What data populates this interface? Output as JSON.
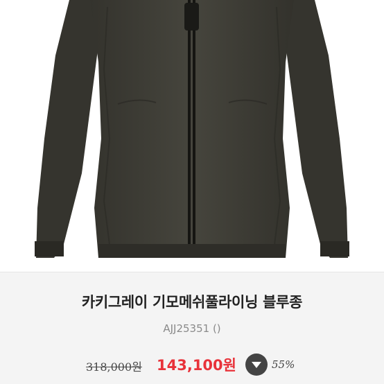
{
  "product": {
    "image_alt": "jacket photo",
    "title": "카키그레이 기모메쉬풀라이닝 블루종",
    "code": "AJJ25351  ()",
    "original_price": "318,000원",
    "sale_price": "143,100원",
    "discount_rate": "55%",
    "discount_icon": "down-arrow-icon"
  },
  "colors": {
    "jacket": "#3f3e37",
    "sale_price": "#e8323a",
    "panel_bg": "#f4f4f4"
  }
}
